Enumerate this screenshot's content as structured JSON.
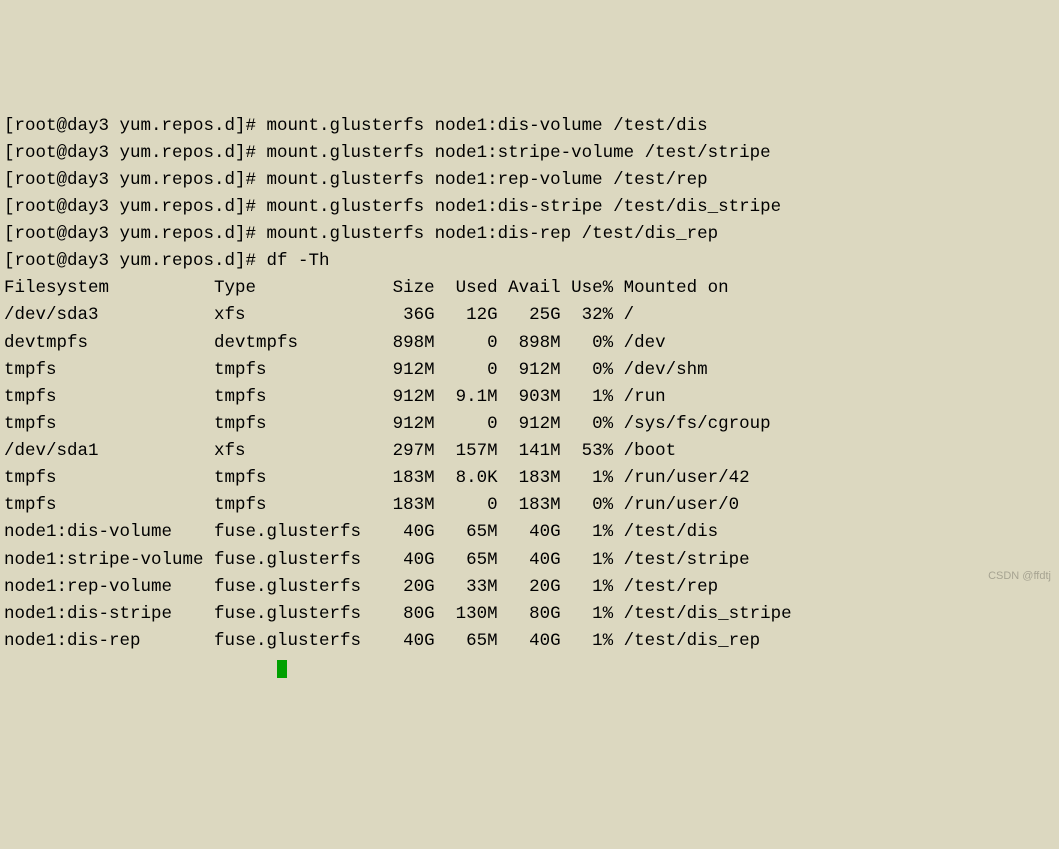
{
  "prompt": "[root@day3 yum.repos.d]# ",
  "commands": [
    "mount.glusterfs node1:dis-volume /test/dis",
    "mount.glusterfs node1:stripe-volume /test/stripe",
    "mount.glusterfs node1:rep-volume /test/rep",
    "mount.glusterfs node1:dis-stripe /test/dis_stripe",
    "mount.glusterfs node1:dis-rep /test/dis_rep",
    "df -Th"
  ],
  "df": {
    "headers": [
      "Filesystem",
      "Type",
      "Size",
      "Used",
      "Avail",
      "Use%",
      "Mounted on"
    ],
    "rows": [
      {
        "fs": "/dev/sda3",
        "type": "xfs",
        "size": "36G",
        "used": "12G",
        "avail": "25G",
        "usep": "32%",
        "mnt": "/"
      },
      {
        "fs": "devtmpfs",
        "type": "devtmpfs",
        "size": "898M",
        "used": "0",
        "avail": "898M",
        "usep": "0%",
        "mnt": "/dev"
      },
      {
        "fs": "tmpfs",
        "type": "tmpfs",
        "size": "912M",
        "used": "0",
        "avail": "912M",
        "usep": "0%",
        "mnt": "/dev/shm"
      },
      {
        "fs": "tmpfs",
        "type": "tmpfs",
        "size": "912M",
        "used": "9.1M",
        "avail": "903M",
        "usep": "1%",
        "mnt": "/run"
      },
      {
        "fs": "tmpfs",
        "type": "tmpfs",
        "size": "912M",
        "used": "0",
        "avail": "912M",
        "usep": "0%",
        "mnt": "/sys/fs/cgroup"
      },
      {
        "fs": "/dev/sda1",
        "type": "xfs",
        "size": "297M",
        "used": "157M",
        "avail": "141M",
        "usep": "53%",
        "mnt": "/boot"
      },
      {
        "fs": "tmpfs",
        "type": "tmpfs",
        "size": "183M",
        "used": "8.0K",
        "avail": "183M",
        "usep": "1%",
        "mnt": "/run/user/42"
      },
      {
        "fs": "tmpfs",
        "type": "tmpfs",
        "size": "183M",
        "used": "0",
        "avail": "183M",
        "usep": "0%",
        "mnt": "/run/user/0"
      },
      {
        "fs": "node1:dis-volume",
        "type": "fuse.glusterfs",
        "size": "40G",
        "used": "65M",
        "avail": "40G",
        "usep": "1%",
        "mnt": "/test/dis"
      },
      {
        "fs": "node1:stripe-volume",
        "type": "fuse.glusterfs",
        "size": "40G",
        "used": "65M",
        "avail": "40G",
        "usep": "1%",
        "mnt": "/test/stripe"
      },
      {
        "fs": "node1:rep-volume",
        "type": "fuse.glusterfs",
        "size": "20G",
        "used": "33M",
        "avail": "20G",
        "usep": "1%",
        "mnt": "/test/rep"
      },
      {
        "fs": "node1:dis-stripe",
        "type": "fuse.glusterfs",
        "size": "80G",
        "used": "130M",
        "avail": "80G",
        "usep": "1%",
        "mnt": "/test/dis_stripe"
      },
      {
        "fs": "node1:dis-rep",
        "type": "fuse.glusterfs",
        "size": "40G",
        "used": "65M",
        "avail": "40G",
        "usep": "1%",
        "mnt": "/test/dis_rep"
      }
    ]
  },
  "watermark": "CSDN @ffdtj"
}
